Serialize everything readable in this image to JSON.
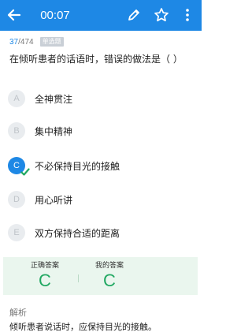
{
  "header": {
    "timer": "00:07",
    "icons": [
      "arrow-left-icon",
      "pencil-icon",
      "star-icon",
      "more-vertical-icon"
    ],
    "accent_color": "#1e88e5"
  },
  "question": {
    "current": "37",
    "total": "/474",
    "tag": "单选题",
    "text": "在倾听患者的话语时，错误的做法是（ ）"
  },
  "options": [
    {
      "letter": "A",
      "text": "全神贯注",
      "selected": false
    },
    {
      "letter": "B",
      "text": "集中精神",
      "selected": false
    },
    {
      "letter": "C",
      "text": "不必保持目光的接触",
      "selected": true
    },
    {
      "letter": "D",
      "text": "用心听讲",
      "selected": false
    },
    {
      "letter": "E",
      "text": "双方保持合适的距离",
      "selected": false
    }
  ],
  "answers": {
    "correct_label": "正确答案",
    "correct_value": "C",
    "mine_label": "我的答案",
    "mine_value": "C",
    "result_color": "#21a862"
  },
  "analysis": {
    "title": "解析",
    "text": "倾听患者说话时，应保持目光的接触。"
  }
}
